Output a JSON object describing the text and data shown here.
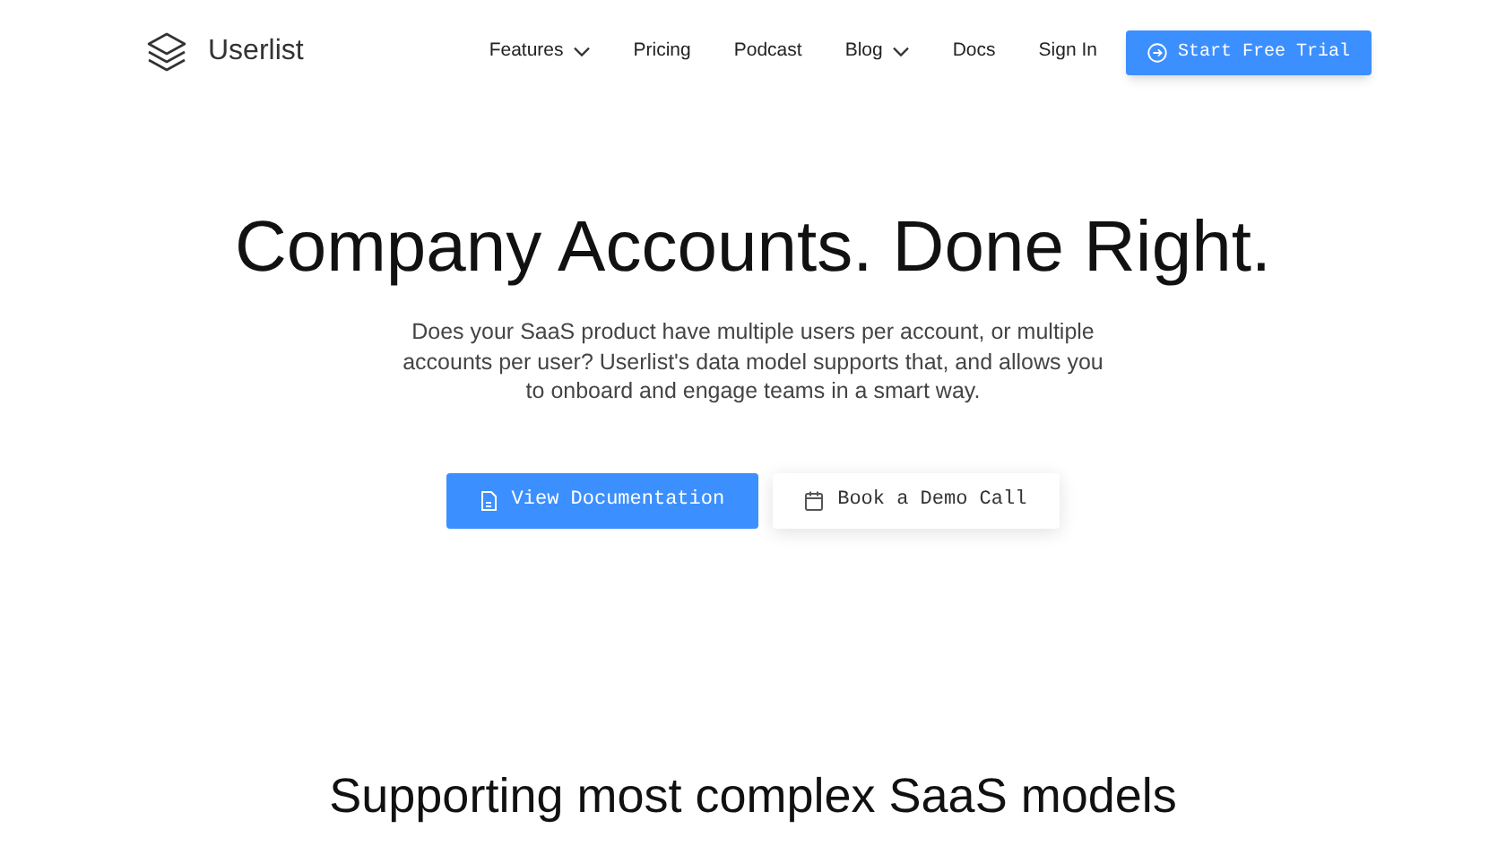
{
  "brand": "Userlist",
  "nav": [
    {
      "label": "Features",
      "kind": "dropdown"
    },
    {
      "label": "Pricing",
      "kind": "link"
    },
    {
      "label": "Podcast",
      "kind": "link"
    },
    {
      "label": "Blog",
      "kind": "dropdown"
    },
    {
      "label": "Docs",
      "kind": "link"
    },
    {
      "label": "Sign In",
      "kind": "link"
    }
  ],
  "cta": "Start Free Trial",
  "hero": {
    "title": "Company Accounts. Done Right.",
    "text": "Does your SaaS product have multiple users per account, or multiple accounts per user? Userlist's data model supports that, and allows you to onboard and engage teams in a smart way.",
    "buttons": [
      {
        "label": "View Documentation",
        "kind": "primary"
      },
      {
        "label": "Book a Demo Call",
        "kind": "secondary"
      }
    ]
  },
  "section_title": "Supporting most complex SaaS models"
}
